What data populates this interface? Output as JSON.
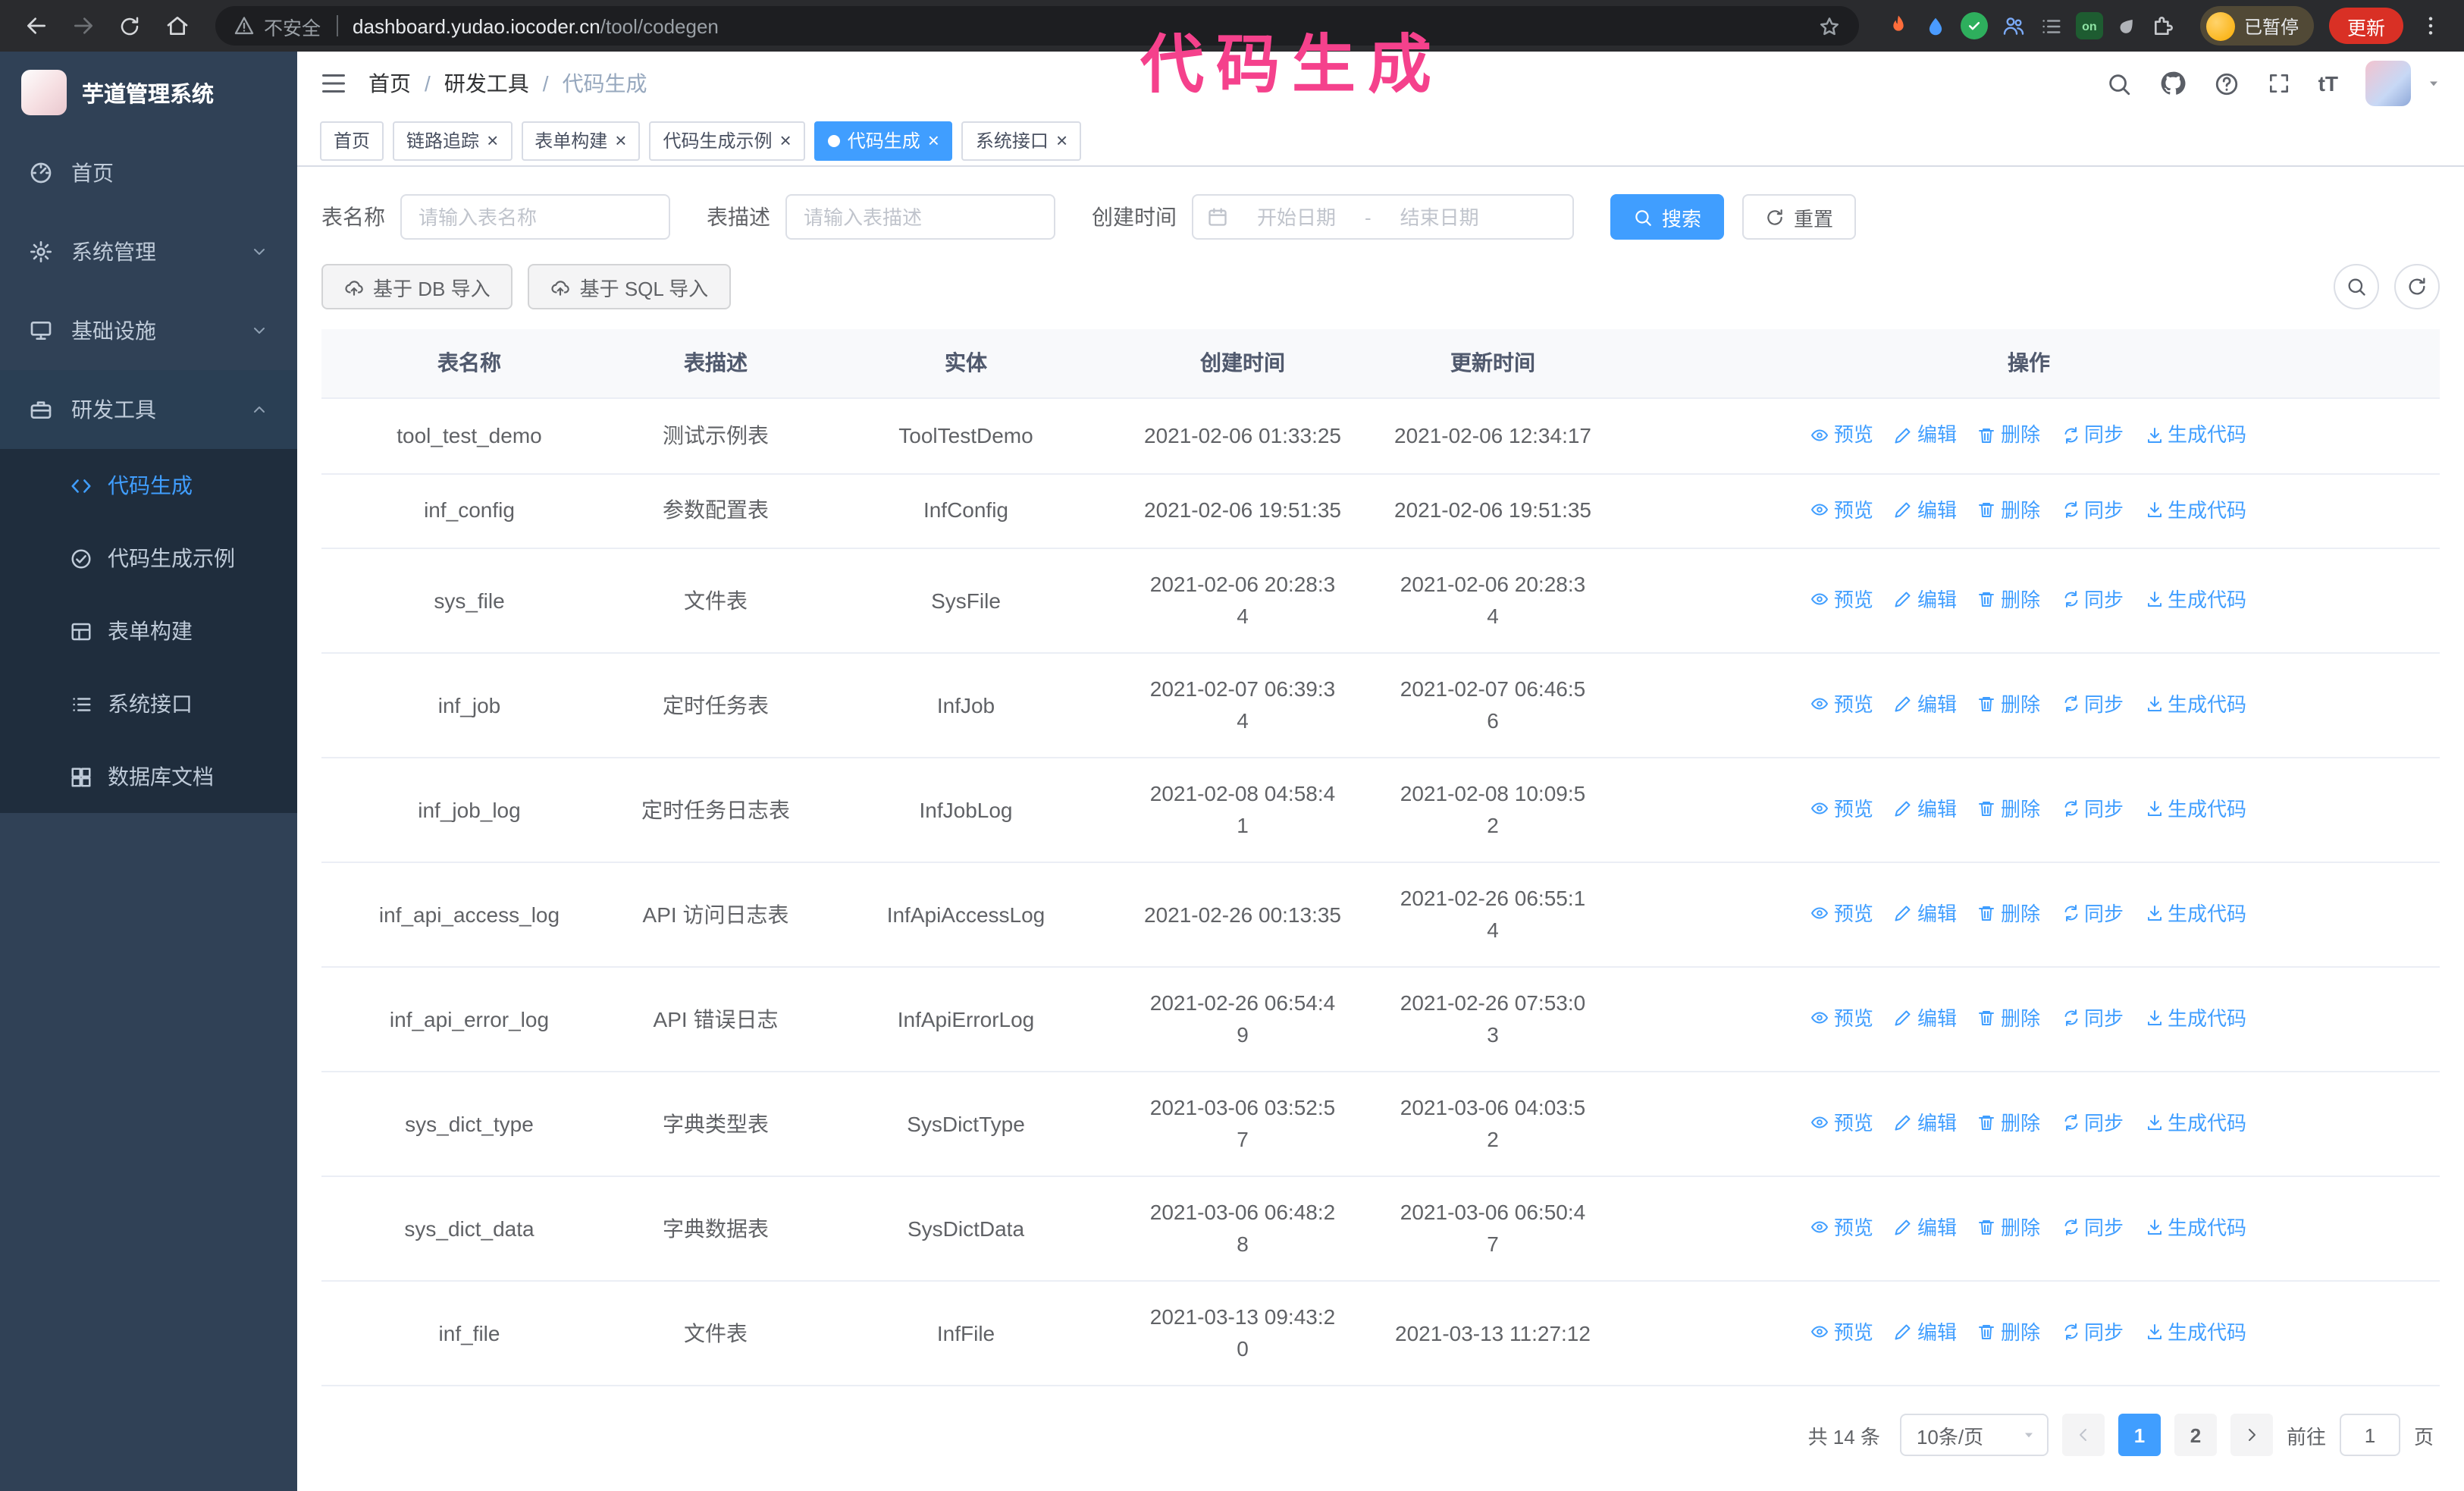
{
  "colors": {
    "primary": "#409eff",
    "link": "#409eff",
    "sidebar_bg": "#304156",
    "submenu_bg": "#1f2d3d",
    "active_tab_bg": "#409eff",
    "overlay_text": "#f5418c",
    "update_button": "#d93025",
    "table_border": "#ebeef5"
  },
  "icon_names": [
    "back-icon",
    "forward-icon",
    "reload-icon",
    "home-icon",
    "warning-icon",
    "star-icon",
    "puzzle-icon",
    "menu-dots-icon",
    "search-icon",
    "github-icon",
    "help-icon",
    "fullscreen-icon",
    "font-size-icon",
    "caret-down-icon",
    "hamburger-icon",
    "calendar-icon",
    "cloud-upload-icon",
    "eye-icon",
    "edit-icon",
    "trash-icon",
    "sync-icon",
    "download-icon"
  ],
  "ui": {
    "close_glyph": "×",
    "active_dot": "dot"
  },
  "browser": {
    "security_text": "不安全",
    "url_host": "dashboard.yudao.iocoder.cn",
    "url_path": "/tool/codegen",
    "ext_on_badge": "on",
    "profile_badge": "已暂停",
    "update_button": "更新"
  },
  "overlay": {
    "text": "代码生成"
  },
  "sidebar": {
    "logo_title": "芋道管理系统",
    "items": [
      {
        "label": "首页",
        "icon": "dashboard-icon"
      },
      {
        "label": "系统管理",
        "icon": "gear-icon",
        "expandable": true
      },
      {
        "label": "基础设施",
        "icon": "monitor-icon",
        "expandable": true
      },
      {
        "label": "研发工具",
        "icon": "toolbox-icon",
        "expandable": true,
        "expanded": true
      }
    ],
    "submenu": [
      {
        "label": "代码生成",
        "icon": "code-icon",
        "active": true
      },
      {
        "label": "代码生成示例",
        "icon": "check-circle-icon"
      },
      {
        "label": "表单构建",
        "icon": "form-icon"
      },
      {
        "label": "系统接口",
        "icon": "list-icon"
      },
      {
        "label": "数据库文档",
        "icon": "grid-icon"
      }
    ]
  },
  "navbar": {
    "breadcrumb": [
      "首页",
      "研发工具",
      "代码生成"
    ],
    "breadcrumb_separator": "/",
    "font_size_icon_text": "tT"
  },
  "tabs": [
    {
      "label": "首页",
      "closable": false,
      "active": false
    },
    {
      "label": "链路追踪",
      "closable": true,
      "active": false
    },
    {
      "label": "表单构建",
      "closable": true,
      "active": false
    },
    {
      "label": "代码生成示例",
      "closable": true,
      "active": false
    },
    {
      "label": "代码生成",
      "closable": true,
      "active": true
    },
    {
      "label": "系统接口",
      "closable": true,
      "active": false
    }
  ],
  "filters": {
    "table_name_label": "表名称",
    "table_name_placeholder": "请输入表名称",
    "table_desc_label": "表描述",
    "table_desc_placeholder": "请输入表描述",
    "create_time_label": "创建时间",
    "date_start_placeholder": "开始日期",
    "date_separator": "-",
    "date_end_placeholder": "结束日期",
    "search_button": "搜索",
    "reset_button": "重置"
  },
  "toolbar": {
    "import_db_button": "基于 DB 导入",
    "import_sql_button": "基于 SQL 导入"
  },
  "table": {
    "columns": [
      "表名称",
      "表描述",
      "实体",
      "创建时间",
      "更新时间",
      "操作"
    ],
    "actions": [
      "预览",
      "编辑",
      "删除",
      "同步",
      "生成代码"
    ],
    "rows": [
      {
        "name": "tool_test_demo",
        "desc": "测试示例表",
        "entity": "ToolTestDemo",
        "created": "2021-02-06 01:33:25",
        "updated": "2021-02-06 12:34:17"
      },
      {
        "name": "inf_config",
        "desc": "参数配置表",
        "entity": "InfConfig",
        "created": "2021-02-06 19:51:35",
        "updated": "2021-02-06 19:51:35"
      },
      {
        "name": "sys_file",
        "desc": "文件表",
        "entity": "SysFile",
        "created": "2021-02-06 20:28:3\n4",
        "updated": "2021-02-06 20:28:3\n4"
      },
      {
        "name": "inf_job",
        "desc": "定时任务表",
        "entity": "InfJob",
        "created": "2021-02-07 06:39:3\n4",
        "updated": "2021-02-07 06:46:5\n6"
      },
      {
        "name": "inf_job_log",
        "desc": "定时任务日志表",
        "entity": "InfJobLog",
        "created": "2021-02-08 04:58:4\n1",
        "updated": "2021-02-08 10:09:5\n2"
      },
      {
        "name": "inf_api_access_log",
        "desc": "API 访问日志表",
        "entity": "InfApiAccessLog",
        "created": "2021-02-26 00:13:35",
        "updated": "2021-02-26 06:55:1\n4"
      },
      {
        "name": "inf_api_error_log",
        "desc": "API 错误日志",
        "entity": "InfApiErrorLog",
        "created": "2021-02-26 06:54:4\n9",
        "updated": "2021-02-26 07:53:0\n3"
      },
      {
        "name": "sys_dict_type",
        "desc": "字典类型表",
        "entity": "SysDictType",
        "created": "2021-03-06 03:52:5\n7",
        "updated": "2021-03-06 04:03:5\n2"
      },
      {
        "name": "sys_dict_data",
        "desc": "字典数据表",
        "entity": "SysDictData",
        "created": "2021-03-06 06:48:2\n8",
        "updated": "2021-03-06 06:50:4\n7"
      },
      {
        "name": "inf_file",
        "desc": "文件表",
        "entity": "InfFile",
        "created": "2021-03-13 09:43:2\n0",
        "updated": "2021-03-13 11:27:12"
      }
    ]
  },
  "pagination": {
    "total": "共 14 条",
    "page_size": "10条/页",
    "pages": [
      "1",
      "2"
    ],
    "current": "1",
    "goto_prefix": "前往",
    "goto_value": "1",
    "goto_suffix": "页"
  }
}
